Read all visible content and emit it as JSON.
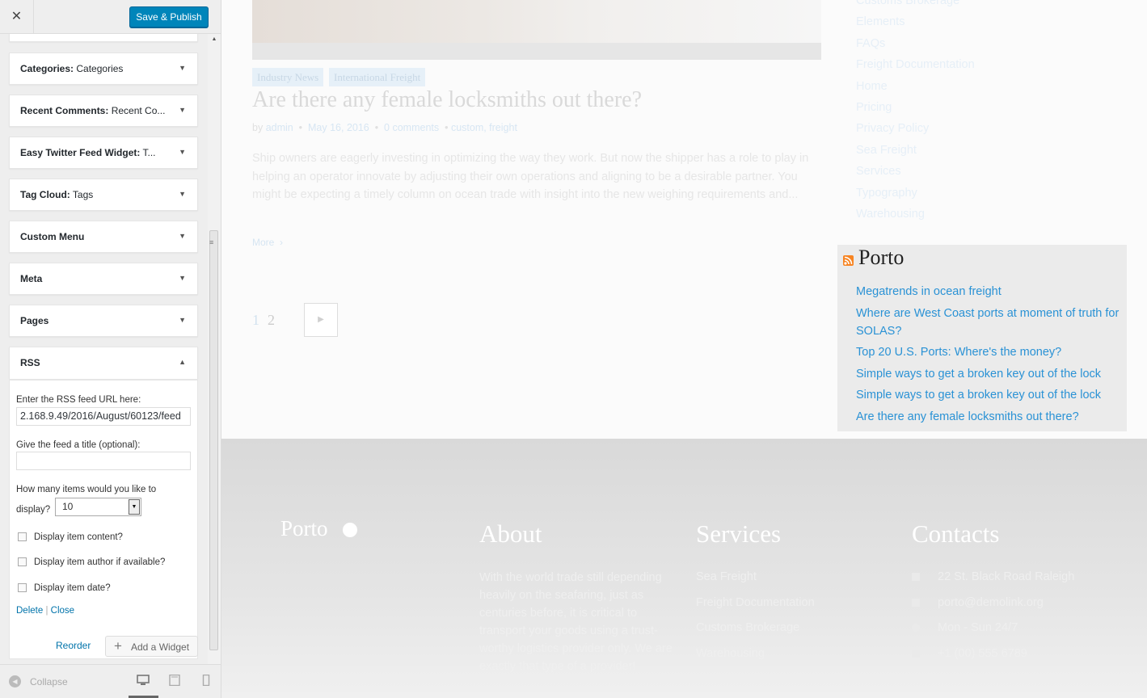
{
  "customizer": {
    "close_icon": "close-icon",
    "save_label": "Save & Publish",
    "widgets": [
      {
        "title": "Categories:",
        "subtitle": "Categories"
      },
      {
        "title": "Recent Comments:",
        "subtitle": "Recent Co..."
      },
      {
        "title": "Easy Twitter Feed Widget:",
        "subtitle": "T..."
      },
      {
        "title": "Tag Cloud:",
        "subtitle": "Tags"
      },
      {
        "title": "Custom Menu",
        "subtitle": ""
      },
      {
        "title": "Meta",
        "subtitle": ""
      },
      {
        "title": "Pages",
        "subtitle": ""
      },
      {
        "title": "RSS",
        "subtitle": ""
      }
    ],
    "rss_form": {
      "url_label": "Enter the RSS feed URL here:",
      "url_value": "2.168.9.49/2016/August/60123/feed",
      "title_label": "Give the feed a title (optional):",
      "title_value": "",
      "items_label_1": "How many items would you like to",
      "items_label_2": "display?",
      "items_value": "10",
      "checkbox_content": "Display item content?",
      "checkbox_author": "Display item author if available?",
      "checkbox_date": "Display item date?",
      "delete_label": "Delete",
      "separator": "|",
      "close_label": "Close"
    },
    "reorder_label": "Reorder",
    "add_widget_label": "Add a Widget",
    "collapse_label": "Collapse"
  },
  "preview": {
    "categories": [
      "Industry News",
      "International Freight"
    ],
    "post_title": "Are there any female locksmiths out there?",
    "meta": {
      "by": "by",
      "author": "admin",
      "date": "May 16, 2016",
      "comments": "0 comments",
      "tags": "custom, freight"
    },
    "excerpt": "Ship owners are eagerly investing in optimizing the way they work. But now the shipper has a role to play in helping an operator innovate by adjusting their own operations and aligning to be a desirable partner. You might be expecting a timely column on ocean trade with insight into the new weighing requirements and...",
    "more_label": "More",
    "pagination": [
      "1",
      "2"
    ],
    "side_links": [
      "Customs Brokerage",
      "Elements",
      "FAQs",
      "Freight Documentation",
      "Home",
      "Pricing",
      "Privacy Policy",
      "Sea Freight",
      "Services",
      "Typography",
      "Warehousing"
    ],
    "rss_widget": {
      "title": "Porto",
      "items": [
        "Megatrends in ocean freight",
        "Where are West Coast ports at moment of truth for SOLAS?",
        "Top 20 U.S. Ports: Where's the money?",
        "Simple ways to get a broken key out of the lock",
        "Simple ways to get a broken key out of the lock",
        "Are there any female locksmiths out there?"
      ]
    },
    "footer": {
      "logo": "Porto",
      "about_heading": "About",
      "about_text": "With the world trade still depending heavily on the seafaring, just as centuries before, it is critical to transport your goods using a trust-worthy logistics provider only. We are exactly that type of a provider!",
      "services_heading": "Services",
      "services": [
        "Sea Freight",
        "Freight Documentation",
        "Customs Brokerage",
        "Warehousing"
      ],
      "contacts_heading": "Contacts",
      "contacts": [
        {
          "icon": "home-icon",
          "text": "22 St. Black Road Raleigh"
        },
        {
          "icon": "monitor-icon",
          "text": "porto@demolink.org"
        },
        {
          "icon": "clock-icon",
          "text": "Mon - Sun 24/7"
        },
        {
          "icon": "phone-icon",
          "text": "+1 (00) 555 6789"
        }
      ]
    }
  }
}
